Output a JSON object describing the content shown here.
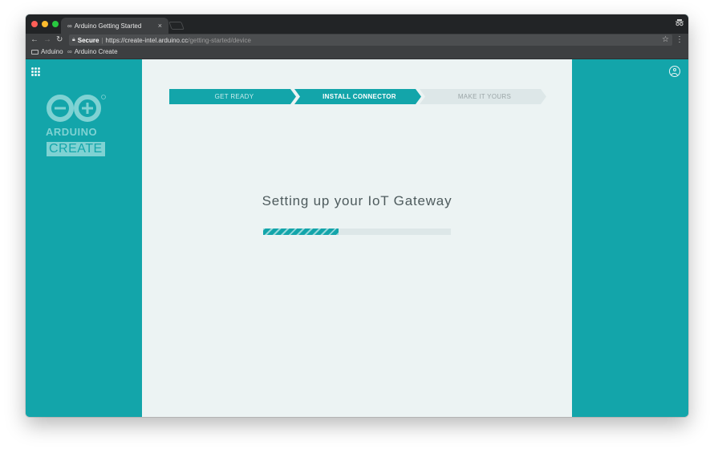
{
  "browser": {
    "tab_title": "Arduino Getting Started",
    "tab_icon": "∞",
    "tab_close": "×",
    "url": {
      "secure_label": "Secure",
      "separator": "|",
      "scheme": "https://",
      "host": "create-intel.arduino.cc",
      "path": "/getting-started/device"
    },
    "bookmarks": [
      {
        "label": "Arduino",
        "icon": "folder-icon"
      },
      {
        "label": "Arduino Create",
        "icon": "infinity-icon"
      }
    ],
    "traffic_lights": [
      "#ff5f57",
      "#febc2e",
      "#28c840"
    ]
  },
  "brand": {
    "wordmark": "ARDUINO",
    "badge": "CREATE",
    "accent": "#13a5aa",
    "logo_tint": "#7fd2d3"
  },
  "steps": [
    {
      "label": "GET READY",
      "state": "done"
    },
    {
      "label": "INSTALL CONNECTOR",
      "state": "active"
    },
    {
      "label": "MAKE IT YOURS",
      "state": "pending"
    }
  ],
  "main": {
    "heading": "Setting up your IoT Gateway",
    "progress_percent": 40
  }
}
